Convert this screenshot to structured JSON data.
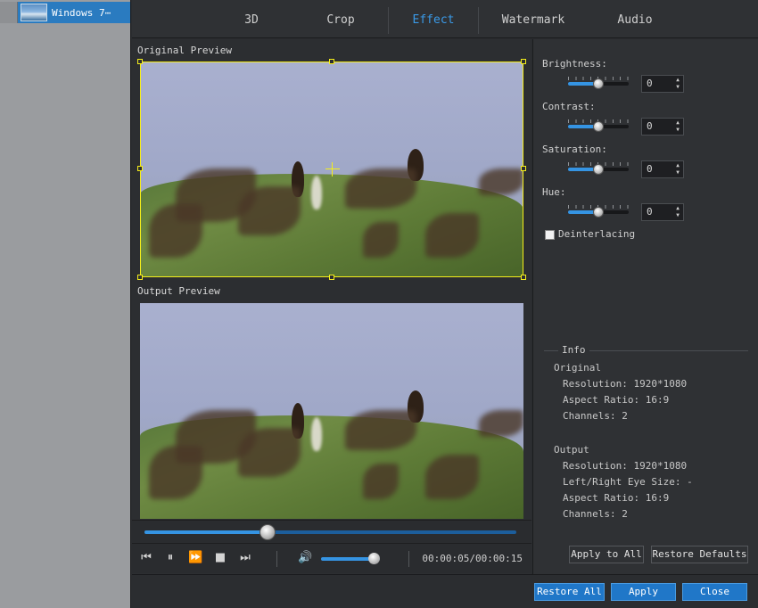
{
  "file_list": {
    "items": [
      {
        "name": "Windows 7⋯"
      }
    ]
  },
  "tabs": [
    {
      "label": "3D"
    },
    {
      "label": "Crop"
    },
    {
      "label": "Effect",
      "active": true
    },
    {
      "label": "Watermark"
    },
    {
      "label": "Audio"
    }
  ],
  "preview": {
    "original_label": "Original Preview",
    "output_label": "Output Preview",
    "time": "00:00:05/00:00:15",
    "progress": 0.33,
    "volume": 0.9
  },
  "effects": {
    "brightness": {
      "label": "Brightness:",
      "value": "0"
    },
    "contrast": {
      "label": "Contrast:",
      "value": "0"
    },
    "saturation": {
      "label": "Saturation:",
      "value": "0"
    },
    "hue": {
      "label": "Hue:",
      "value": "0"
    },
    "deinterlacing": {
      "label": "Deinterlacing",
      "checked": false
    }
  },
  "info": {
    "title": "Info",
    "original": {
      "heading": "Original",
      "resolution": "Resolution: 1920*1080",
      "aspect_ratio": "Aspect Ratio: 16:9",
      "channels": "Channels: 2"
    },
    "output": {
      "heading": "Output",
      "resolution": "Resolution: 1920*1080",
      "eye_size": "Left/Right Eye Size: -",
      "aspect_ratio": "Aspect Ratio: 16:9",
      "channels": "Channels: 2"
    }
  },
  "buttons": {
    "apply_to_all": "Apply to All",
    "restore_defaults": "Restore Defaults",
    "restore_all": "Restore All",
    "apply": "Apply",
    "close": "Close"
  },
  "colors": {
    "accent": "#3594e3",
    "crop_frame": "#f5ee1a",
    "selected_item": "#2a7bc0"
  }
}
